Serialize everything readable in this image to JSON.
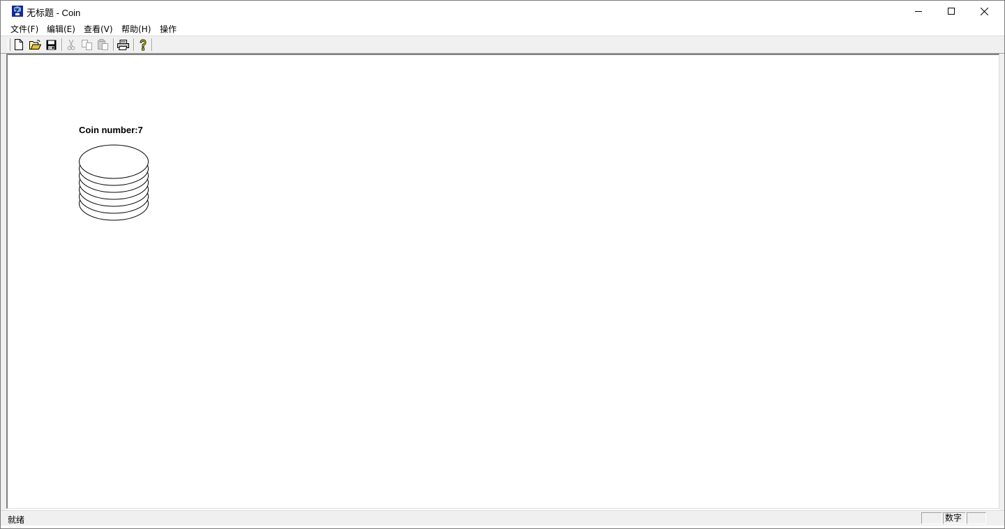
{
  "window": {
    "title": "无标题 - Coin"
  },
  "menu": {
    "items": [
      "文件(F)",
      "编辑(E)",
      "查看(V)",
      "帮助(H)",
      "操作"
    ]
  },
  "toolbar": {
    "buttons": [
      {
        "icon": "new-file-icon",
        "enabled": true
      },
      {
        "icon": "open-folder-icon",
        "enabled": true
      },
      {
        "icon": "save-icon",
        "enabled": true
      },
      {
        "icon": "cut-icon",
        "enabled": false
      },
      {
        "icon": "copy-icon",
        "enabled": false
      },
      {
        "icon": "paste-icon",
        "enabled": false
      },
      {
        "icon": "print-icon",
        "enabled": true
      },
      {
        "icon": "help-icon",
        "enabled": true
      }
    ]
  },
  "canvas": {
    "coin_label": "Coin number:7",
    "coin_count": 7
  },
  "status": {
    "text": "就绪",
    "num_indicator": "数字"
  },
  "colors": {
    "window_bg": "#ffffff",
    "chrome_bg": "#f0f0f0",
    "coin_stroke": "#000000"
  }
}
